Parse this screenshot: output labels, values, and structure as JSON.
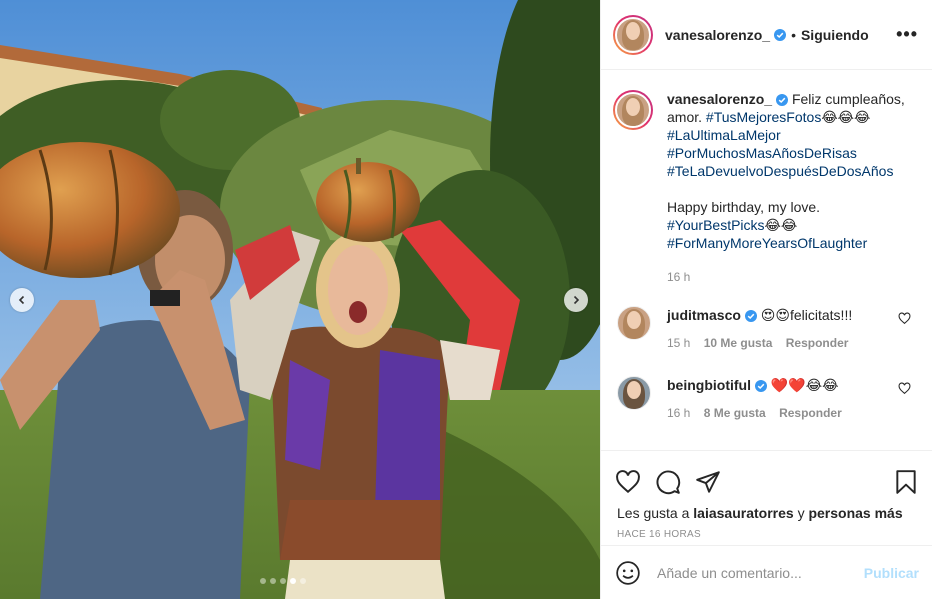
{
  "post": {
    "author": "vanesalorenzo_",
    "following_separator": "•",
    "following_label": "Siguiendo",
    "more_label": "•••"
  },
  "caption": {
    "user": "vanesalorenzo_",
    "line1": " Feliz cumpleaños, amor. ",
    "tag1": "#TusMejoresFotos",
    "emoji1": "😂😂😂",
    "tag2": "#LaUltimaLaMejor",
    "tag3": "#PorMuchosMasAñosDeRisas",
    "tag4": "#TeLaDevuelvoDespuésDeDosAños",
    "line2": "Happy birthday, my love.",
    "tag5": "#YourBestPicks",
    "emoji2": "😂😂",
    "tag6": "#ForManyMoreYearsOfLaughter",
    "time": "16 h"
  },
  "comments": [
    {
      "user": "juditmasco",
      "text": "😍😍felicitats!!!",
      "time": "15 h",
      "likes": "10 Me gusta",
      "reply": "Responder"
    },
    {
      "user": "beingbiotiful",
      "text": "❤️❤️😂😂",
      "time": "16 h",
      "likes": "8 Me gusta",
      "reply": "Responder"
    }
  ],
  "actions": {
    "likes_prefix": "Les gusta a ",
    "likes_user": "laiasauratorres",
    "likes_mid": " y ",
    "likes_others": "personas más",
    "ago": "HACE 16 HORAS"
  },
  "comment_box": {
    "placeholder": "Añade un comentario...",
    "publish_label": "Publicar"
  },
  "carousel": {
    "slide_count": 5,
    "active_slide": 3
  },
  "icons": [
    "chevron-left-icon",
    "chevron-right-icon",
    "verified-icon",
    "more-icon",
    "heart-icon",
    "comment-icon",
    "share-icon",
    "bookmark-icon",
    "emoji-icon"
  ],
  "colors": {
    "link": "#00376b",
    "verified": "#3897f0",
    "publish": "#b2dffc",
    "muted": "#8e8e8e"
  }
}
